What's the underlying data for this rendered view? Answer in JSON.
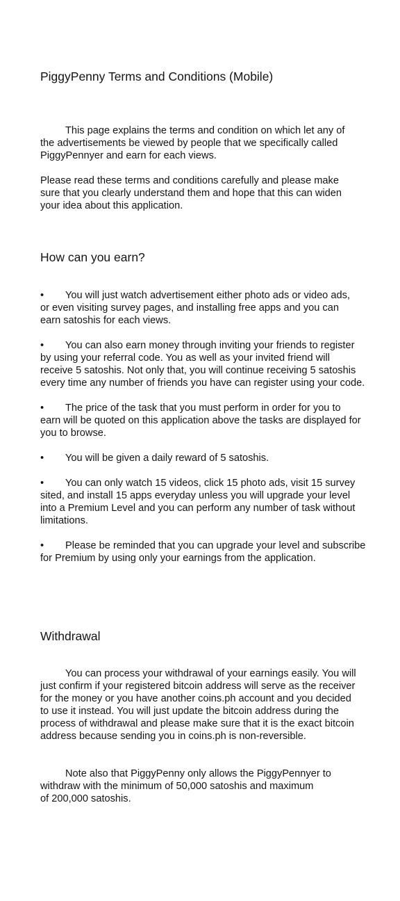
{
  "document": {
    "title": "PiggyPenny Terms and Conditions (Mobile)",
    "intro": [
      [
        "This page explains the terms and condition on which let any of",
        "the advertisements be viewed by people that we specifically called",
        "PiggyPennyer and earn for each views."
      ],
      [
        "Please read these terms and conditions carefully and please make",
        "sure that you clearly understand them and hope that this can widen",
        "your idea about this application."
      ]
    ],
    "earn_heading": "How can you earn?",
    "bullet_symbol": "•",
    "earn_items": [
      [
        "You will just watch advertisement either photo ads or video ads,",
        "or even visiting survey pages, and installing free apps and you can",
        "earn satoshis for each views."
      ],
      [
        "You can also earn money through inviting your friends to register",
        "by using your referral code. You as well as your invited friend will",
        "receive 5 satoshis. Not only that, you will continue receiving 5 satoshis",
        "every time any number of friends you have can register using your code."
      ],
      [
        "The price of the task that you must perform in order for you to",
        "earn will be quoted on this application above the tasks are displayed for",
        "you to browse."
      ],
      [
        "You will be given a daily reward of 5 satoshis."
      ],
      [
        "You can only watch 15 videos, click 15 photo ads, visit 15 survey",
        "sited, and install 15 apps everyday unless you will upgrade your level",
        "into a Premium Level and you can perform any number of task without",
        "limitations."
      ],
      [
        "Please be reminded that you can upgrade your level and subscribe",
        "for Premium by using only your earnings from the application."
      ]
    ],
    "withdrawal_heading": "Withdrawal",
    "withdrawal_paragraphs": [
      [
        "You can process your withdrawal of your earnings easily. You will",
        "just confirm if your registered bitcoin address will serve as the receiver",
        "for the money or you have another coins.ph account and you decided",
        "to use it instead. You will just update the bitcoin address during the",
        "process of withdrawal and please make sure that it is the exact bitcoin",
        "address because sending you in coins.ph is non-reversible."
      ],
      [
        "Note also that PiggyPenny only allows the PiggyPennyer to",
        "withdraw with the minimum of 50,000 satoshis and maximum",
        "of 200,000 satoshis."
      ]
    ]
  }
}
